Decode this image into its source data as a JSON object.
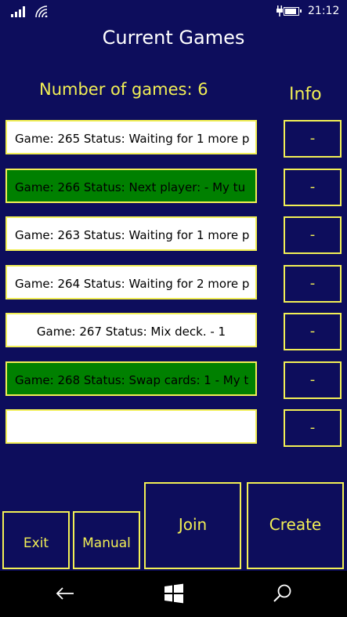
{
  "status_bar": {
    "time": "21:12",
    "icons": [
      "signal-icon",
      "wifi-icon",
      "charging-icon",
      "battery-icon"
    ]
  },
  "header": {
    "title": "Current Games",
    "games_count": "Number of games: 6",
    "info_label": "Info"
  },
  "games": [
    {
      "text": "Game: 265   Status: Waiting for 1 more p",
      "highlight": false
    },
    {
      "text": "Game: 266   Status: Next player: - My tu",
      "highlight": true
    },
    {
      "text": "Game: 263   Status: Waiting for 1 more p",
      "highlight": false
    },
    {
      "text": "Game: 264   Status: Waiting for 2 more p",
      "highlight": false
    },
    {
      "text": "Game: 267   Status: Mix deck. - 1",
      "highlight": false
    },
    {
      "text": "Game: 268   Status: Swap cards: 1 - My t",
      "highlight": true
    },
    {
      "text": "",
      "highlight": false
    }
  ],
  "info_buttons": [
    "-",
    "-",
    "-",
    "-",
    "-",
    "-",
    "-"
  ],
  "actions": {
    "exit": "Exit",
    "manual": "Manual",
    "join": "Join",
    "create": "Create"
  },
  "nav": {
    "icons": [
      "back-arrow-icon",
      "windows-start-icon",
      "search-icon"
    ]
  },
  "colors": {
    "background": "#0d0d5c",
    "accent": "#f2ef55",
    "highlight_row": "#008000",
    "row": "#ffffff"
  }
}
